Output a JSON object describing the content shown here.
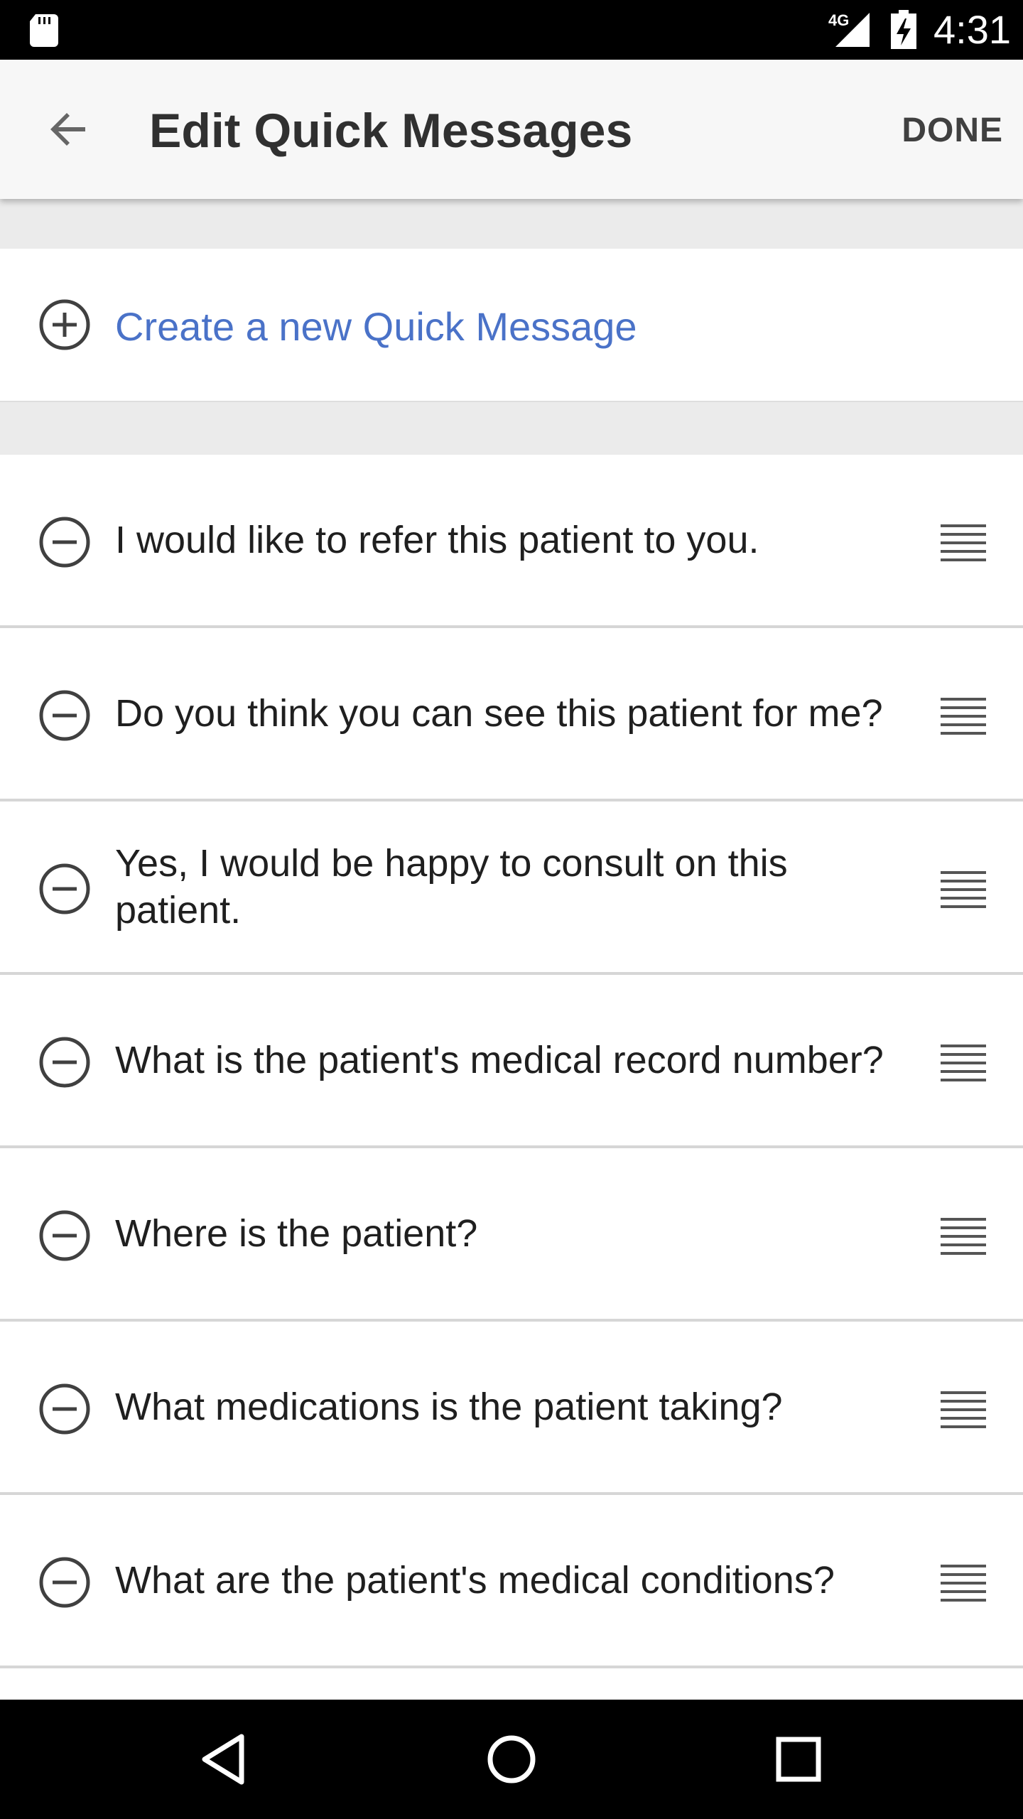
{
  "status_bar": {
    "network": "4G",
    "time": "4:31"
  },
  "app_bar": {
    "title": "Edit Quick Messages",
    "done_label": "DONE"
  },
  "create": {
    "label": "Create a new Quick Message"
  },
  "messages": [
    {
      "text": "I would like to refer this patient to you."
    },
    {
      "text": "Do you think you can see this patient for me?"
    },
    {
      "text": "Yes, I would be happy to consult on this patient."
    },
    {
      "text": "What is the patient's medical record number?"
    },
    {
      "text": "Where is the patient?"
    },
    {
      "text": "What medications is the patient taking?"
    },
    {
      "text": "What are the patient's medical conditions?"
    }
  ],
  "colors": {
    "accent": "#4a72c8",
    "app_bar_bg": "#f7f7f7",
    "separator_bg": "#ebebeb",
    "system_bars": "#000000"
  }
}
